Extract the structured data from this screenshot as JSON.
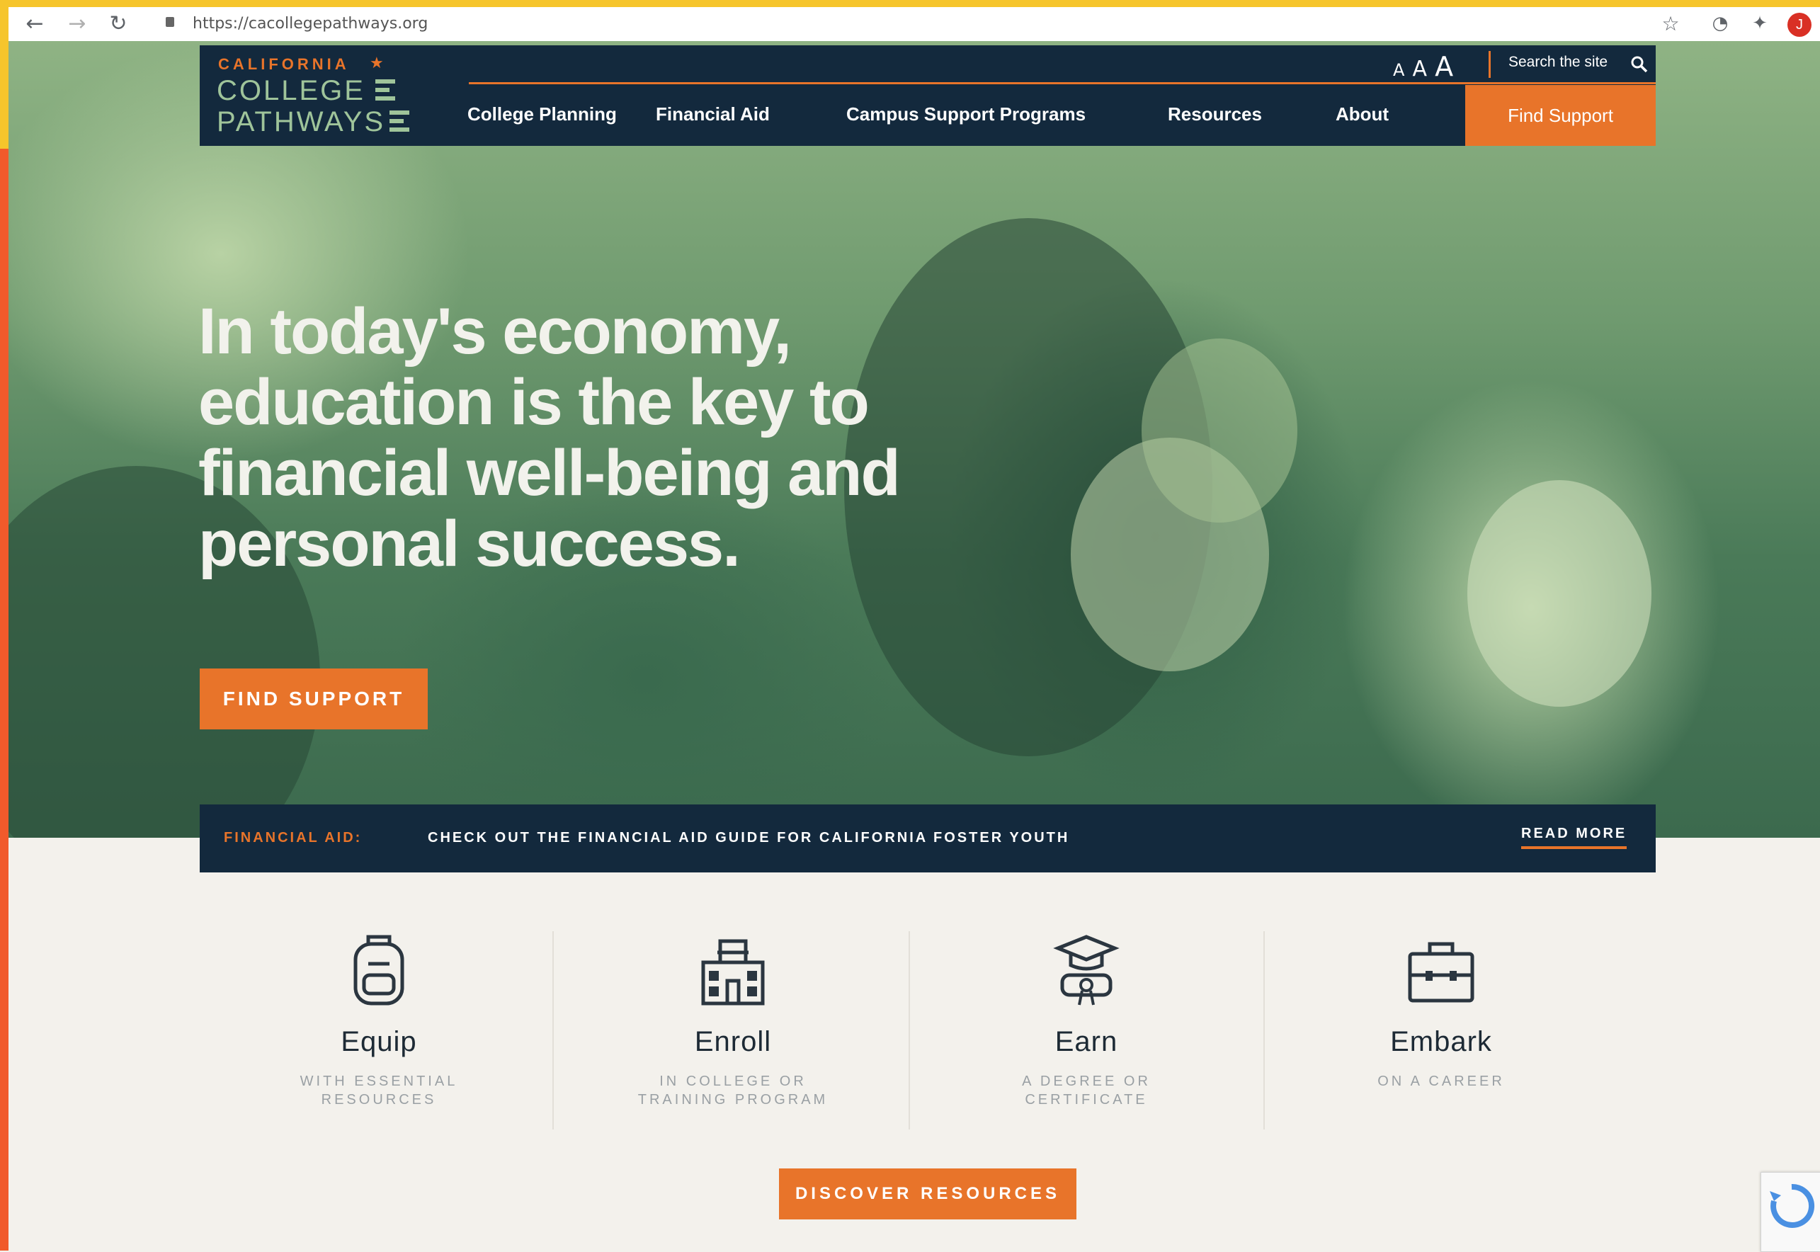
{
  "browser": {
    "url": "https://cacollegepathways.org",
    "profile_initial": "J"
  },
  "header": {
    "logo": {
      "top": "CALIFORNIA",
      "line1": "COLLEGE",
      "line2": "PATHWAYS"
    },
    "text_size_controls": [
      "A",
      "A",
      "A"
    ],
    "search_placeholder": "Search the site",
    "nav": [
      "College Planning",
      "Financial Aid",
      "Campus Support Programs",
      "Resources",
      "About"
    ],
    "cta": "Find Support"
  },
  "hero": {
    "headline_lines": [
      "In today's economy,",
      "education is the key to",
      "financial well-being and",
      "personal success."
    ],
    "button": "FIND SUPPORT"
  },
  "notice": {
    "label": "FINANCIAL AID:",
    "text": "CHECK OUT THE FINANCIAL AID GUIDE FOR CALIFORNIA FOSTER YOUTH",
    "link": "READ MORE"
  },
  "features": [
    {
      "title": "Equip",
      "subtitle": "WITH ESSENTIAL RESOURCES",
      "icon": "backpack-icon"
    },
    {
      "title": "Enroll",
      "subtitle": "IN COLLEGE OR TRAINING PROGRAM",
      "icon": "school-building-icon"
    },
    {
      "title": "Earn",
      "subtitle": "A DEGREE OR CERTIFICATE",
      "icon": "diploma-cap-icon"
    },
    {
      "title": "Embark",
      "subtitle": "ON A CAREER",
      "icon": "briefcase-icon"
    }
  ],
  "discover_button": "DISCOVER RESOURCES",
  "colors": {
    "navy": "#13293d",
    "orange": "#e8742a",
    "green": "#4a7a58",
    "sage": "#9fc49a"
  }
}
